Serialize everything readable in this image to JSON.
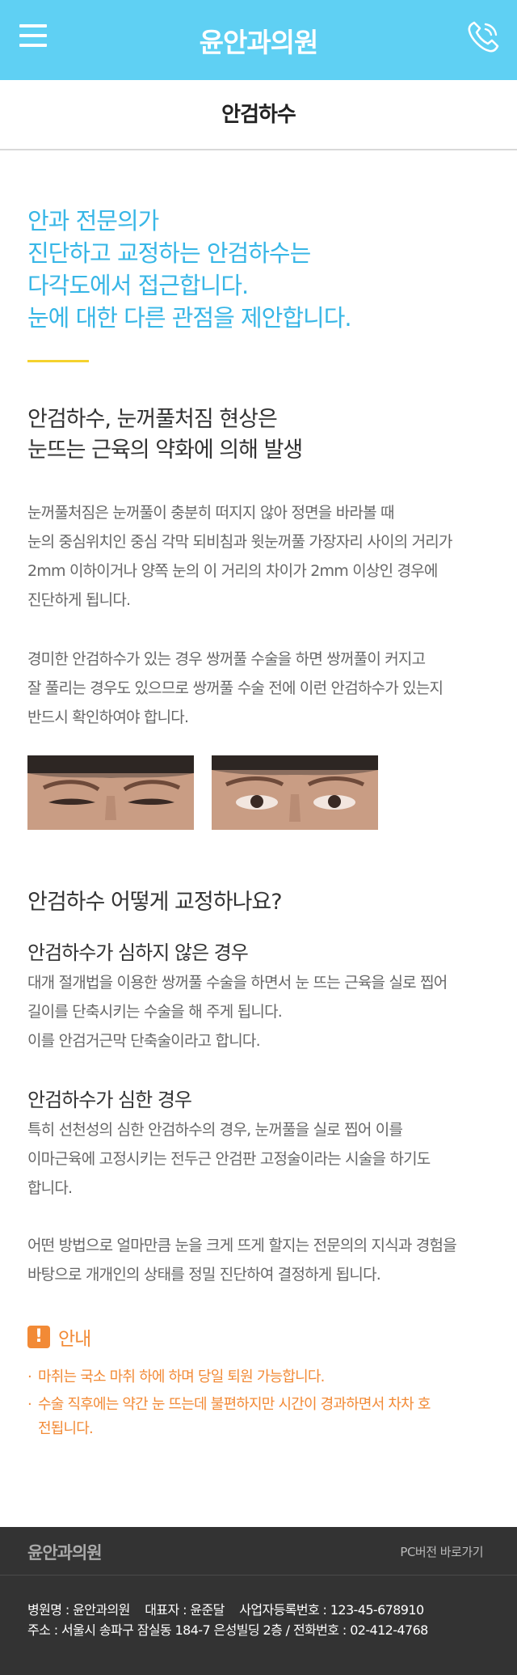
{
  "header": {
    "brand": "윤안과의원",
    "menu_icon": "hamburger-icon",
    "phone_icon": "phone-icon",
    "color": "#5fd0f3"
  },
  "page": {
    "title": "안검하수"
  },
  "intro": {
    "lines": [
      "안과 전문의가",
      "진단하고 교정하는 안검하수는",
      "다각도에서 접근합니다.",
      "눈에 대한 다른 관점을 제안합니다."
    ],
    "color": "#37b6e6"
  },
  "section1": {
    "heading": [
      "안검하수, 눈꺼풀처짐 현상은",
      "눈뜨는 근육의 약화에 의해 발생"
    ],
    "para1": [
      "눈꺼풀처짐은 눈꺼풀이 충분히 떠지지 않아 정면을 바라볼 때",
      "눈의 중심위치인 중심 각막 되비침과 윗눈꺼풀 가장자리 사이의 거리가",
      "2mm 이하이거나 양쪽 눈의 이 거리의 차이가 2mm 이상인 경우에",
      "진단하게 됩니다."
    ],
    "para2": [
      "경미한 안검하수가 있는 경우 쌍꺼풀 수술을 하면 쌍꺼풀이 커지고",
      "잘 풀리는 경우도 있으므로 쌍꺼풀 수술 전에 이런 안검하수가 있는지",
      "반드시 확인하여야 합니다."
    ]
  },
  "section2": {
    "heading": "안검하수 어떻게 교정하나요?",
    "case1": {
      "title": "안검하수가 심하지 않은 경우",
      "lines": [
        "대개 절개법을 이용한 쌍꺼풀 수술을 하면서 눈 뜨는 근육을 실로 찝어",
        "길이를 단축시키는 수술을 해 주게 됩니다.",
        "이를 안검거근막 단축술이라고 합니다."
      ]
    },
    "case2": {
      "title": "안검하수가 심한 경우",
      "lines": [
        "특히 선천성의 심한 안검하수의 경우, 눈꺼풀을 실로 찝어 이를",
        "이마근육에 고정시키는 전두근 안검판 고정술이라는 시술을 하기도",
        "합니다."
      ]
    },
    "closing": [
      "어떤 방법으로 얼마만큼 눈을 크게 뜨게 할지는 전문의의 지식과 경험을",
      "바탕으로 개개인의 상태를 정밀 진단하여 결정하게 됩니다."
    ]
  },
  "notice": {
    "icon": "!",
    "title": "안내",
    "items": [
      "마취는 국소 마취 하에 하며 당일 퇴원 가능합니다.",
      "수술 직후에는 약간 눈 뜨는데 불편하지만 시간이 경과하면서 차차 호전됩니다."
    ],
    "color": "#f28a36"
  },
  "footer": {
    "logo": "윤안과의원",
    "pc_link": "PC버전 바로가기",
    "hospital": "병원명 : 윤안과의원",
    "ceo": "대표자 : 윤준달",
    "biz_no": "사업자등록번호 : 123-45-678910",
    "address_line": "주소 : 서울시 송파구 잠실동 184-7 은성빌딩 2층  / 전화번호 : 02-412-4768"
  }
}
